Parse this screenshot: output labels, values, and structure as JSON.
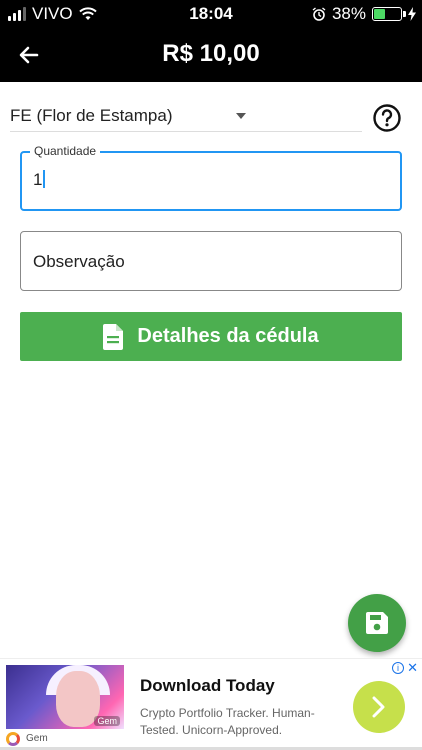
{
  "status_bar": {
    "carrier": "VIVO",
    "time": "18:04",
    "battery_percent": "38%",
    "battery_level": 0.38
  },
  "app_bar": {
    "title": "R$ 10,00",
    "back_icon": "arrow-left-icon"
  },
  "form": {
    "type_select": {
      "value": "FE (Flor de Estampa)"
    },
    "help_icon": "help-circle-icon",
    "quantity": {
      "label": "Quantidade",
      "value": "1"
    },
    "observation": {
      "placeholder": "Observação"
    },
    "details_button": {
      "label": "Detalhes da cédula",
      "icon": "document-icon"
    },
    "save_fab_icon": "save-icon"
  },
  "ad": {
    "headline": "Download Today",
    "body": "Crypto Portfolio Tracker. Human-Tested. Unicorn-Approved.",
    "advertiser": "Gem",
    "thumb_brand": "Gem"
  },
  "colors": {
    "app_bar": "#000000",
    "accent_blue": "#2196f3",
    "button_green": "#4caf50",
    "fab_green": "#43a047",
    "ad_cta": "#c6e04b"
  }
}
